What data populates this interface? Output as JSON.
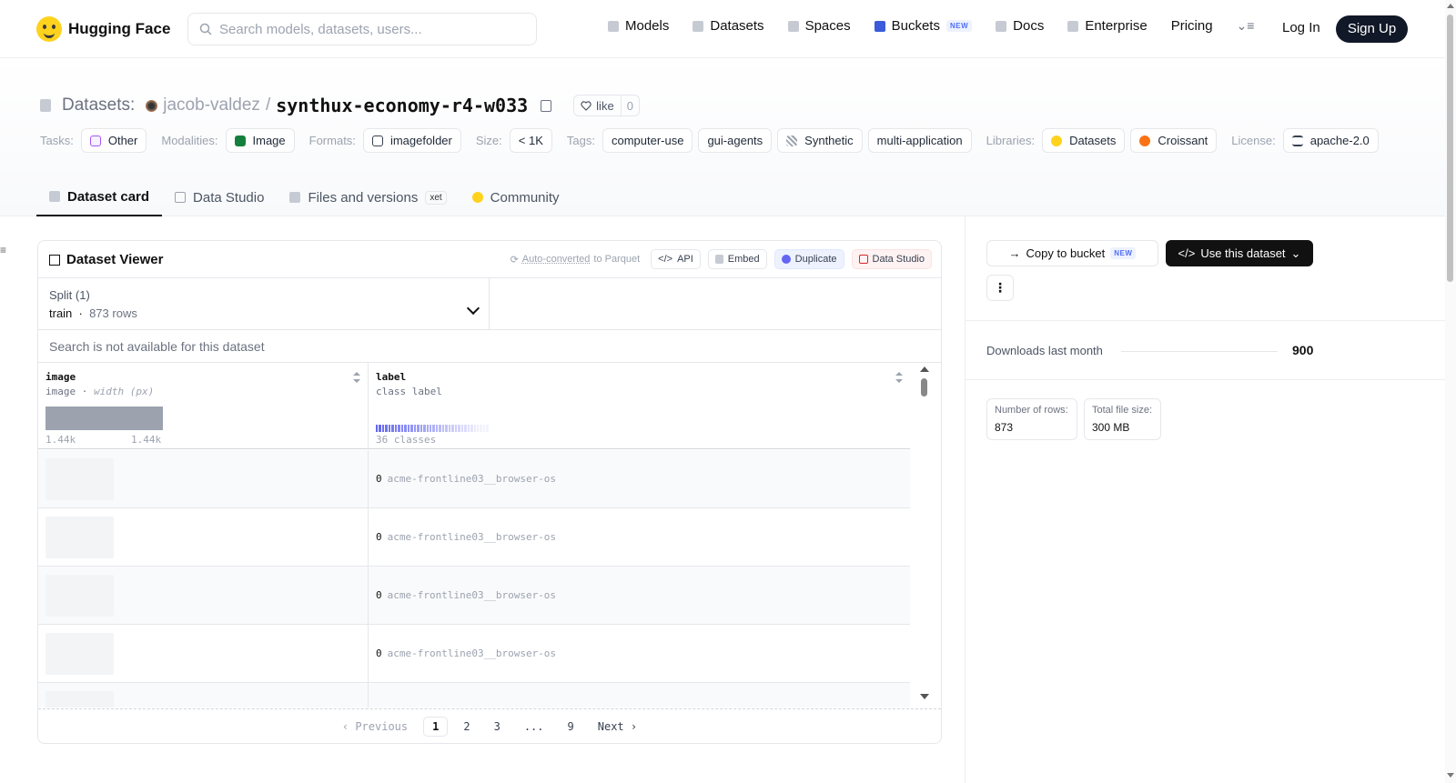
{
  "header": {
    "brand": "Hugging Face",
    "search_placeholder": "Search models, datasets, users...",
    "nav": [
      {
        "label": "Models",
        "icon": "models-icon"
      },
      {
        "label": "Datasets",
        "icon": "datasets-icon"
      },
      {
        "label": "Spaces",
        "icon": "spaces-icon"
      },
      {
        "label": "Buckets",
        "icon": "buckets-icon",
        "badge": "NEW"
      },
      {
        "label": "Docs",
        "icon": "docs-icon"
      },
      {
        "label": "Enterprise",
        "icon": "enterprise-icon"
      },
      {
        "label": "Pricing"
      }
    ],
    "login": "Log In",
    "signup": "Sign Up"
  },
  "dataset": {
    "prefix": "Datasets:",
    "owner": "jacob-valdez",
    "separator": "/",
    "name": "synthux-economy-r4-w033",
    "like_label": "like",
    "like_count": "0"
  },
  "tags": {
    "tasks_label": "Tasks:",
    "task": "Other",
    "modalities_label": "Modalities:",
    "modality": "Image",
    "formats_label": "Formats:",
    "format": "imagefolder",
    "size_label": "Size:",
    "size": "< 1K",
    "tags_label": "Tags:",
    "tag_list": [
      "computer-use",
      "gui-agents",
      "Synthetic",
      "multi-application"
    ],
    "libraries_label": "Libraries:",
    "libraries": [
      "Datasets",
      "Croissant"
    ],
    "license_label": "License:",
    "license": "apache-2.0"
  },
  "tabs": {
    "card": "Dataset card",
    "studio": "Data Studio",
    "files": "Files and versions",
    "xet": "xet",
    "community": "Community"
  },
  "viewer": {
    "title": "Dataset Viewer",
    "autoconv_pre": "Auto-converted",
    "autoconv_post": "to Parquet",
    "api": "API",
    "embed": "Embed",
    "duplicate": "Duplicate",
    "data_studio": "Data Studio",
    "split_label": "Split (1)",
    "split_name": "train",
    "split_rows": "873 rows",
    "search_msg": "Search is not available for this dataset",
    "col1": {
      "name": "image",
      "type": "image",
      "sub": "width (px)",
      "min": "1.44k",
      "max": "1.44k"
    },
    "col2": {
      "name": "label",
      "type": "class label",
      "classes": "36 classes"
    },
    "rows": [
      {
        "label_id": "0",
        "label_text": "acme-frontline03__browser-os"
      },
      {
        "label_id": "0",
        "label_text": "acme-frontline03__browser-os"
      },
      {
        "label_id": "0",
        "label_text": "acme-frontline03__browser-os"
      },
      {
        "label_id": "0",
        "label_text": "acme-frontline03__browser-os"
      },
      {
        "label_id": "",
        "label_text": ""
      }
    ],
    "pager": {
      "prev": "Previous",
      "pages": [
        "1",
        "2",
        "3",
        "...",
        "9"
      ],
      "next": "Next",
      "current": "1"
    }
  },
  "sidebar": {
    "copy_bucket": "Copy to bucket",
    "copy_badge": "NEW",
    "use_dataset": "Use this dataset",
    "downloads_label": "Downloads last month",
    "downloads_value": "900",
    "rows_label": "Number of rows:",
    "rows_value": "873",
    "size_label": "Total file size:",
    "size_value": "300 MB"
  },
  "colors": {
    "accent": "#6366f1",
    "signup_bg": "#111827",
    "brand_yellow": "#FFD21E"
  }
}
